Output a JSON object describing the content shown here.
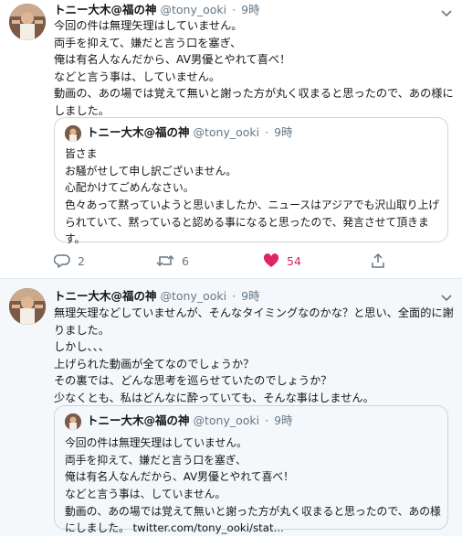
{
  "tweets": [
    {
      "name": "トニー大木@福の神",
      "handle": "@tony_ooki",
      "time": "9時",
      "text_lines": [
        "今回の件は無理矢理はしていません。",
        "両手を抑えて、嫌だと言う口を塞ぎ、",
        "俺は有名人なんだから、AV男優とやれて喜べ！",
        "などと言う事は、していません。",
        "動画の、あの場では覚えて無いと謝った方が丸く収まると思ったので、あの様に",
        "しました。"
      ],
      "quote": {
        "name": "トニー大木@福の神",
        "handle": "@tony_ooki",
        "time": "9時",
        "text_lines": [
          "皆さま",
          "お騒がせして申し訳ございません。",
          "心配かけてごめんなさい。",
          "色々あって黙っていようと思いましたか、ニュースはアジアでも沢山取り上げ",
          "られていて、黙っていると認める事になると思ったので、発言させて頂きま",
          "す。"
        ]
      },
      "actions": {
        "reply_count": "2",
        "retweet_count": "6",
        "like_count": "54"
      }
    },
    {
      "name": "トニー大木@福の神",
      "handle": "@tony_ooki",
      "time": "9時",
      "text_lines": [
        "無理矢理などしていませんが、そんなタイミングなのかな？と思い、全面的に謝",
        "りました。",
        "しかし、、、",
        "上げられた動画が全てなのでしょうか？",
        "その裏では、どんな思考を巡らせていたのでしょうか？",
        "少なくとも、私はどんなに酔っていても、そんな事はしません。"
      ],
      "quote": {
        "name": "トニー大木@福の神",
        "handle": "@tony_ooki",
        "time": "9時",
        "text_lines": [
          "今回の件は無理矢理はしていません。",
          "両手を抑えて、嫌だと言う口を塞ぎ、",
          "俺は有名人なんだから、AV男優とやれて喜べ！",
          "などと言う事は、していません。",
          "動画の、あの場では覚えて無いと謝った方が丸く収まると思ったので、あの様",
          "にしました。 twitter.com/tony_ooki/stat..."
        ]
      }
    }
  ],
  "colors": {
    "text": "#14171a",
    "secondary": "#657786",
    "border": "#ccd6dd",
    "like": "#e0245e",
    "tweet2_background": "#f5f8fa"
  },
  "icons": {
    "reply": "reply-icon",
    "retweet": "retweet-icon",
    "like": "heart-icon",
    "share": "share-icon",
    "menu": "chevron-down-icon"
  }
}
